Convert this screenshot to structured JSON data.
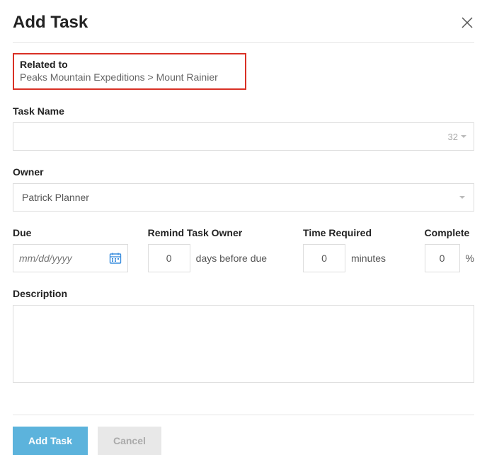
{
  "header": {
    "title": "Add Task"
  },
  "related": {
    "label": "Related to",
    "path": "Peaks Mountain Expeditions > Mount Rainier"
  },
  "task_name": {
    "label": "Task Name",
    "value": "",
    "counter": "32"
  },
  "owner": {
    "label": "Owner",
    "value": "Patrick Planner"
  },
  "due": {
    "label": "Due",
    "placeholder": "mm/dd/yyyy",
    "value": ""
  },
  "remind": {
    "label": "Remind Task Owner",
    "value": "0",
    "suffix": "days before due"
  },
  "time_required": {
    "label": "Time Required",
    "value": "0",
    "suffix": "minutes"
  },
  "complete": {
    "label": "Complete",
    "value": "0",
    "suffix": "%"
  },
  "description": {
    "label": "Description",
    "value": ""
  },
  "footer": {
    "add": "Add Task",
    "cancel": "Cancel"
  }
}
